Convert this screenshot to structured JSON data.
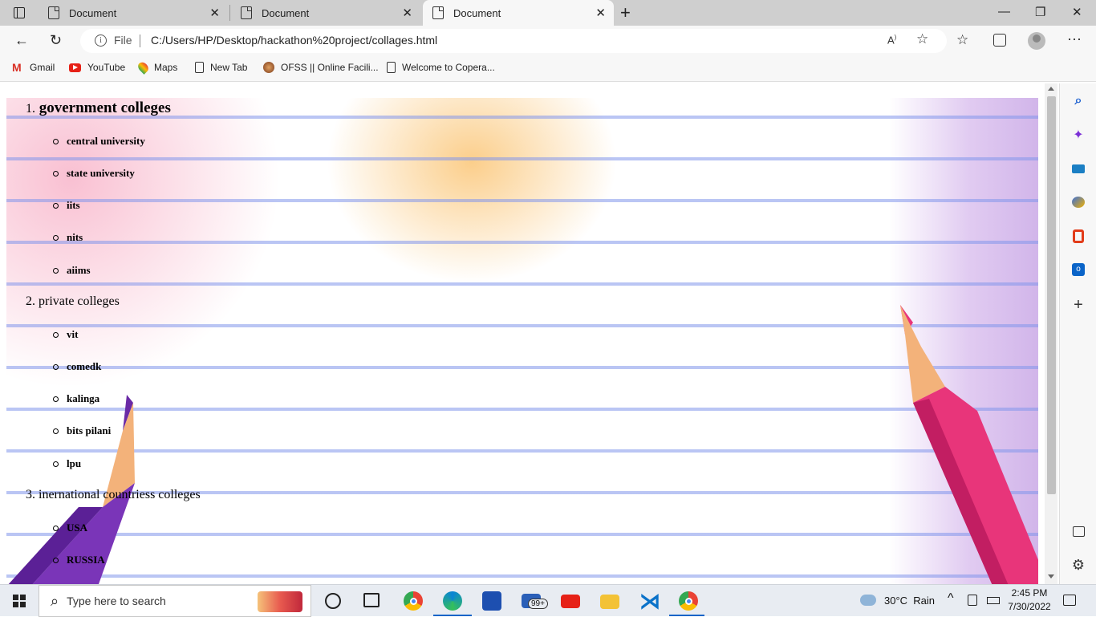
{
  "browser": {
    "tabs": [
      {
        "title": "Document",
        "active": false
      },
      {
        "title": "Document",
        "active": false
      },
      {
        "title": "Document",
        "active": true
      }
    ],
    "new_tab_symbol": "+",
    "address": {
      "scheme_label": "File",
      "url": "C:/Users/HP/Desktop/hackathon%20project/collages.html"
    },
    "bookmarks": [
      "Gmail",
      "YouTube",
      "Maps",
      "New Tab",
      "OFSS || Online Facili...",
      "Welcome to Copera..."
    ]
  },
  "page": {
    "sections": [
      {
        "number": "1.",
        "title": "government colleges",
        "emphasis": true,
        "items": [
          "central university",
          "state university",
          "iits",
          "nits",
          "aiims"
        ]
      },
      {
        "number": "2.",
        "title": "private colleges",
        "emphasis": false,
        "items": [
          "vit",
          "comedk",
          "kalinga",
          "bits pilani",
          "lpu"
        ]
      },
      {
        "number": "3.",
        "title": "inernational countriess colleges",
        "emphasis": false,
        "items": [
          "USA",
          "RUSSIA"
        ]
      }
    ]
  },
  "taskbar": {
    "search_placeholder": "Type here to search",
    "mail_badge": "99+",
    "weather": "30°C  Rain",
    "time": "2:45 PM",
    "date": "7/30/2022"
  },
  "colors": {
    "accent_pink": "#e8357a",
    "pencil_purple": "#6a2aa6",
    "pencil_tip_orange": "#f3b27a",
    "rule_blue": "#8396eb"
  }
}
